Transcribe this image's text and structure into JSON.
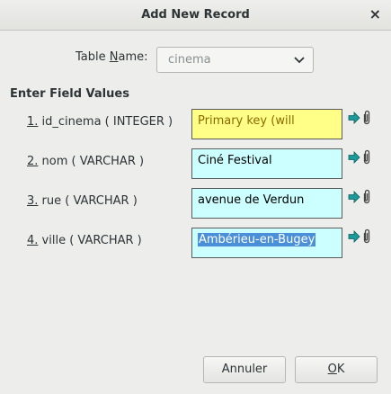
{
  "dialog": {
    "title": "Add New Record",
    "close_glyph": "×"
  },
  "table_name": {
    "label_pre": "Table ",
    "label_mnemonic": "N",
    "label_post": "ame:",
    "value": "cinema"
  },
  "section_title": "Enter Field Values",
  "fields": [
    {
      "num": "1.",
      "name": " id_cinema ( INTEGER )",
      "value": "Primary key (will",
      "primary_key": true
    },
    {
      "num": "2.",
      "name": " nom ( VARCHAR )",
      "value": "Ciné Festival"
    },
    {
      "num": "3.",
      "name": " rue ( VARCHAR )",
      "value": "avenue de Verdun"
    },
    {
      "num": "4.",
      "name": " ville ( VARCHAR )",
      "value": "Ambérieu-en-Bugey",
      "selected": true
    }
  ],
  "buttons": {
    "cancel": "Annuler",
    "ok_mnemonic": "O",
    "ok_rest": "K"
  },
  "icons": {
    "dropdown": "chevron-down-icon",
    "insert": "arrow-right-icon",
    "attach": "paperclip-icon"
  },
  "colors": {
    "field_bg": "#ccffff",
    "primary_key_bg": "#ffff88",
    "selection": "#4a90d9",
    "arrow": "#1a9a9a"
  }
}
